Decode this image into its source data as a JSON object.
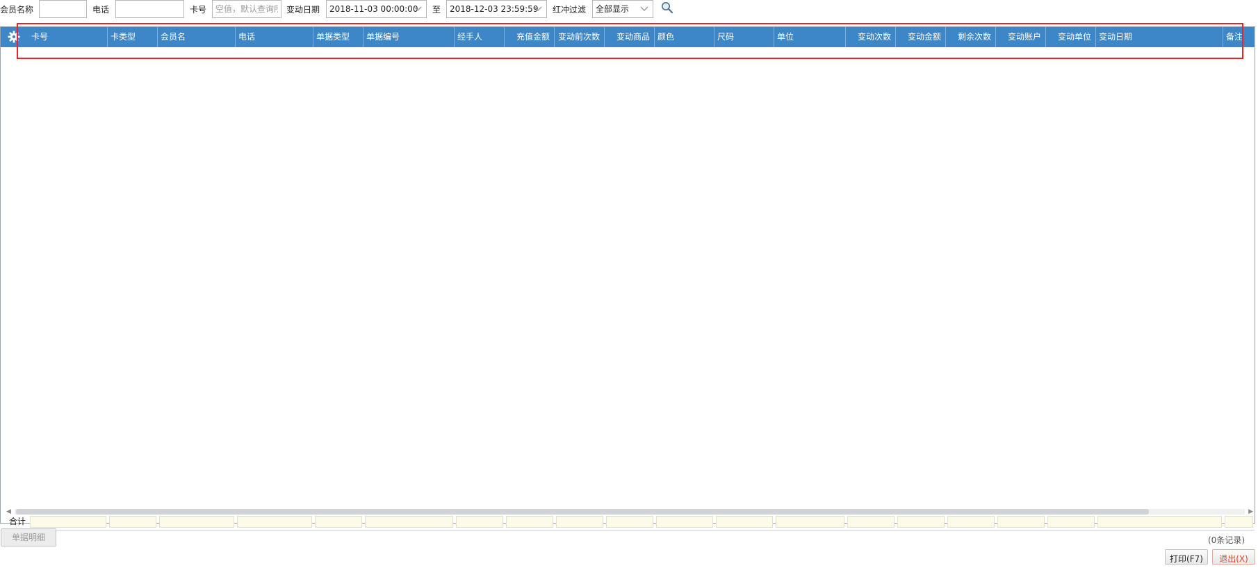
{
  "filters": {
    "member_name_label": "会员名称",
    "member_name_value": "",
    "phone_label": "电话",
    "phone_value": "",
    "card_label": "卡号",
    "card_placeholder": "空值，默认查询所",
    "date_label": "变动日期",
    "date_from": "2018-11-03 00:00:00",
    "date_to_label": "至",
    "date_to": "2018-12-03 23:59:59",
    "reversal_label": "红冲过滤",
    "reversal_value": "全部显示"
  },
  "grid": {
    "columns": [
      {
        "key": "card_no",
        "label": "卡号"
      },
      {
        "key": "card_type",
        "label": "卡类型"
      },
      {
        "key": "member",
        "label": "会员名"
      },
      {
        "key": "phone",
        "label": "电话"
      },
      {
        "key": "doc_type",
        "label": "单据类型"
      },
      {
        "key": "doc_no",
        "label": "单据编号"
      },
      {
        "key": "handler",
        "label": "经手人"
      },
      {
        "key": "recharge",
        "label": "充值金额"
      },
      {
        "key": "before_count",
        "label": "变动前次数"
      },
      {
        "key": "goods",
        "label": "变动商品"
      },
      {
        "key": "color",
        "label": "颜色"
      },
      {
        "key": "size",
        "label": "尺码"
      },
      {
        "key": "unit",
        "label": "单位"
      },
      {
        "key": "change_count",
        "label": "变动次数"
      },
      {
        "key": "change_amount",
        "label": "变动金额"
      },
      {
        "key": "remain_count",
        "label": "剩余次数"
      },
      {
        "key": "account",
        "label": "变动账户"
      },
      {
        "key": "change_unit",
        "label": "变动单位"
      },
      {
        "key": "change_date",
        "label": "变动日期"
      },
      {
        "key": "remark",
        "label": "备注"
      }
    ],
    "rows": [],
    "totals_label": "合计",
    "record_count": "(0条记录)"
  },
  "buttons": {
    "detail": "单据明细",
    "print": "打印(F7)",
    "exit": "退出(X)"
  },
  "colors": {
    "header_bg": "#3d86c8",
    "highlight": "#e8242a",
    "exit_text": "#d9472b"
  }
}
